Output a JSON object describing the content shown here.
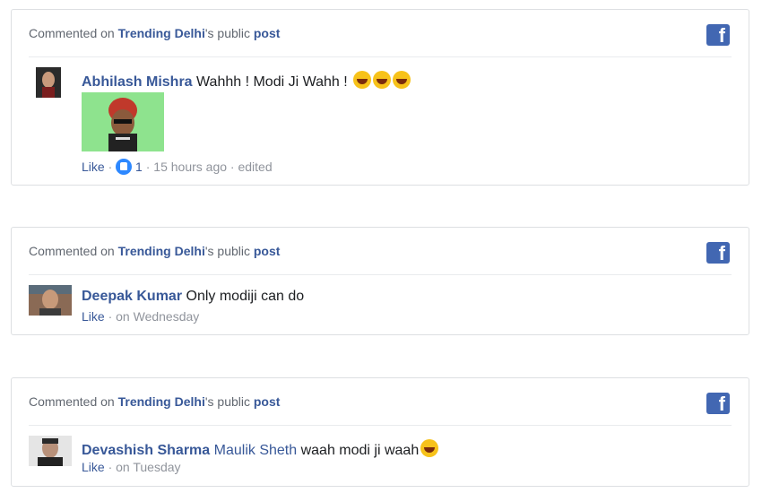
{
  "notifications": [
    {
      "header": {
        "prefix": "Commented on ",
        "page": "Trending Delhi",
        "suffix": "'s public ",
        "post": "post"
      },
      "comment": {
        "author": "Abhilash Mishra",
        "tag": "",
        "text": "Wahhh ! Modi Ji Wahh ! ",
        "emojis": [
          "laughing-emoji",
          "laughing-emoji",
          "laughing-emoji"
        ],
        "has_sticker": true
      },
      "meta": {
        "like": "Like",
        "sep": " · ",
        "reaction_count": "1",
        "time": "15 hours ago",
        "edited": "edited"
      }
    },
    {
      "header": {
        "prefix": "Commented on ",
        "page": "Trending Delhi",
        "suffix": "'s public ",
        "post": "post"
      },
      "comment": {
        "author": "Deepak Kumar",
        "tag": "",
        "text": "Only modiji can do"
      },
      "meta": {
        "like": "Like",
        "sep": " · ",
        "time": "on Wednesday"
      }
    },
    {
      "header": {
        "prefix": "Commented on ",
        "page": "Trending Delhi",
        "suffix": "'s public ",
        "post": "post"
      },
      "comment": {
        "author": "Devashish Sharma",
        "tag": "Maulik Sheth",
        "text": "waah modi ji waah"
      },
      "meta": {
        "like": "Like",
        "sep": " · ",
        "time": "on Tuesday"
      }
    }
  ],
  "colors": {
    "link": "#385898",
    "facebook_blue": "#4267b2",
    "border": "#dddfe2",
    "muted": "#90949c"
  },
  "icons": {
    "brand": "facebook-icon",
    "reaction": "like-reaction-icon"
  }
}
